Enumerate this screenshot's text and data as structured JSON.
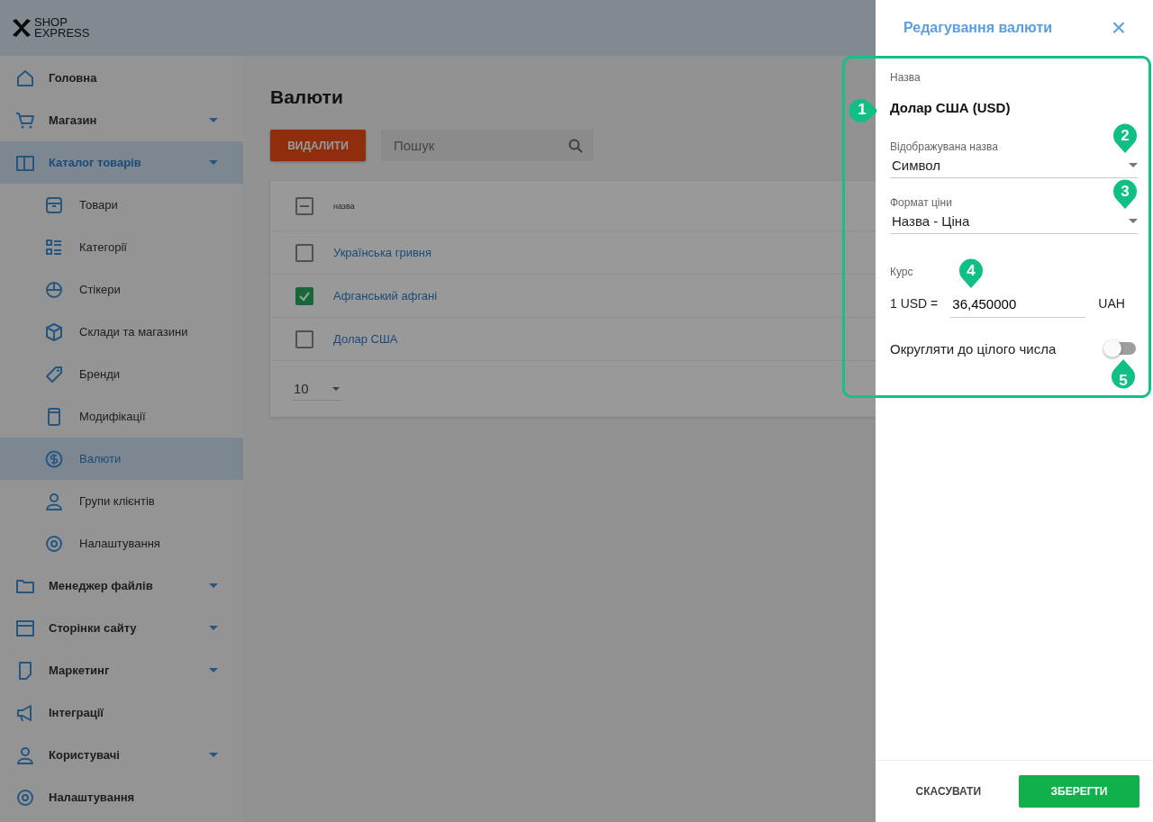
{
  "logo": {
    "line_1": "SHOP",
    "line_2": "EXPRESS"
  },
  "sidebar": {
    "items": [
      {
        "label": "Головна",
        "selected": false,
        "has_children": false
      },
      {
        "label": "Магазин",
        "selected": false,
        "has_children": true
      },
      {
        "label": "Каталог товарів",
        "selected": true,
        "has_children": true,
        "children": [
          {
            "label": "Товари",
            "selected": false
          },
          {
            "label": "Категорії",
            "selected": false
          },
          {
            "label": "Стікери",
            "selected": false
          },
          {
            "label": "Склади та магазини",
            "selected": false
          },
          {
            "label": "Бренди",
            "selected": false
          },
          {
            "label": "Модифікації",
            "selected": false
          },
          {
            "label": "Валюти",
            "selected": true
          },
          {
            "label": "Групи клієнтів",
            "selected": false
          },
          {
            "label": "Налаштування",
            "selected": false
          }
        ]
      },
      {
        "label": "Менеджер файлів",
        "selected": false,
        "has_children": true
      },
      {
        "label": "Сторінки сайту",
        "selected": false,
        "has_children": true
      },
      {
        "label": "Маркетинг",
        "selected": false,
        "has_children": true
      },
      {
        "label": "Інтеграції",
        "selected": false,
        "has_children": false
      },
      {
        "label": "Користувачі",
        "selected": false,
        "has_children": true
      },
      {
        "label": "Налаштування",
        "selected": false,
        "has_children": false
      }
    ]
  },
  "page": {
    "title": "Валюти",
    "delete_button": "ВИДАЛИТИ",
    "search": {
      "placeholder": "Пошук"
    }
  },
  "table": {
    "header": {
      "label": "назва",
      "indeterminate": true
    },
    "rows": [
      {
        "name": "Українська гривня",
        "checked": false
      },
      {
        "name": "Афганський афгані",
        "checked": true
      },
      {
        "name": "Долар США",
        "checked": false
      }
    ],
    "page_size": "10"
  },
  "drawer": {
    "title": "Редагування валюти",
    "close": "×",
    "name_label": "Назва",
    "name_value": "Долар США (USD)",
    "name_callout": "1",
    "selects": [
      {
        "label": "Відображувана назва",
        "value": "Символ",
        "callout": "2"
      },
      {
        "label": "Формат ціни",
        "value": "Назва - Ціна",
        "callout": "3"
      }
    ],
    "rate": {
      "label": "Курс",
      "prefix": "1 USD =",
      "value": "36,450000",
      "suffix": "UAH",
      "callout": "4"
    },
    "round": {
      "label": "Округляти до цілого числа",
      "on": false,
      "callout": "5"
    },
    "cancel_button": "СКАСУВАТИ",
    "save_button": "ЗБЕРЕГТИ"
  }
}
